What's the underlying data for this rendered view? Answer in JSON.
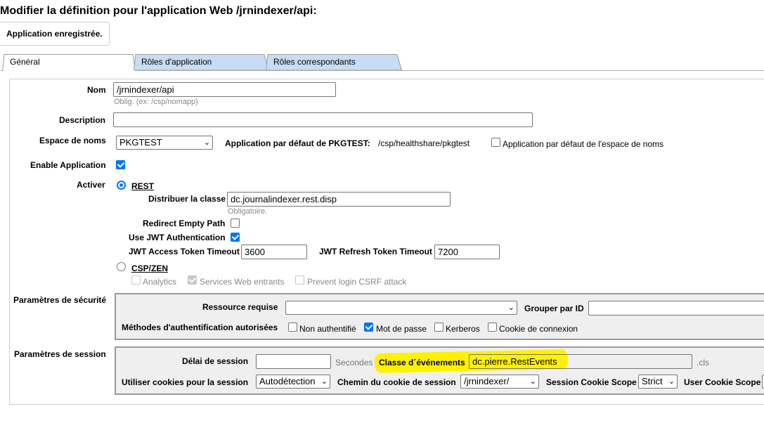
{
  "page": {
    "title": "Modifier la définition pour l'application Web /jrnindexer/api:",
    "status_message": "Application enregistrée."
  },
  "tabs": [
    {
      "label": "Général",
      "active": true
    },
    {
      "label": "Rôles d'application",
      "active": false
    },
    {
      "label": "Rôles correspondants",
      "active": false
    }
  ],
  "colors": {
    "tab_inactive": "#c9dcf5",
    "highlight": "#fff200",
    "checkbox_on": "#0075ff"
  },
  "general": {
    "name_label": "Nom",
    "name_value": "/jrnindexer/api",
    "name_hint": "Oblig. (ex: /csp/nomapp)",
    "description_label": "Description",
    "description_value": "",
    "namespace_label": "Espace de noms",
    "namespace_value": "PKGTEST",
    "default_app_label": "Application par défaut de PKGTEST:",
    "default_app_value": "/csp/healthshare/pkgtest",
    "default_ns_checkbox_label": "Application par défaut de l'espace de noms",
    "enable_label": "Enable Application",
    "activer_label": "Activer",
    "rest_label": "REST",
    "dispatch_label": "Distribuer la classe",
    "dispatch_value": "dc.journalindexer.rest.disp",
    "dispatch_hint": "Obligatoire.",
    "redirect_label": "Redirect Empty Path",
    "jwt_label": "Use JWT Authentication",
    "jwt_access_label": "JWT Access Token Timeout",
    "jwt_access_value": "3600",
    "jwt_refresh_label": "JWT Refresh Token Timeout",
    "jwt_refresh_value": "7200",
    "csp_label": "CSP/ZEN",
    "analytics_label": "Analytics",
    "services_label": "Services Web entrants",
    "csrf_label": "Prevent login CSRF attack"
  },
  "security": {
    "section_label": "Paramètres de sécurité",
    "resource_label": "Ressource requise",
    "resource_value": "",
    "group_label": "Grouper par ID",
    "group_value": "",
    "auth_label": "Méthodes d'authentification autorisées",
    "auth_options": [
      {
        "label": "Non authentifié",
        "checked": false
      },
      {
        "label": "Mot de passe",
        "checked": true
      },
      {
        "label": "Kerberos",
        "checked": false
      },
      {
        "label": "Cookie de connexion",
        "checked": false
      }
    ]
  },
  "session": {
    "section_label": "Paramètres de session",
    "timeout_label": "Délai de session",
    "timeout_value": "",
    "timeout_unit": "Secondes",
    "event_class_label": "Classe d´événements",
    "event_class_value": "dc.pierre.RestEvents",
    "event_class_suffix": ".cls",
    "cookies_label": "Utiliser cookies pour la session",
    "cookies_value": "Autodétection",
    "cookie_path_label": "Chemin du cookie de session",
    "cookie_path_value": "/jrnindexer/",
    "cookie_scope_label": "Session Cookie Scope",
    "cookie_scope_value": "Strict",
    "user_cookie_scope_label": "User Cookie Scope"
  }
}
